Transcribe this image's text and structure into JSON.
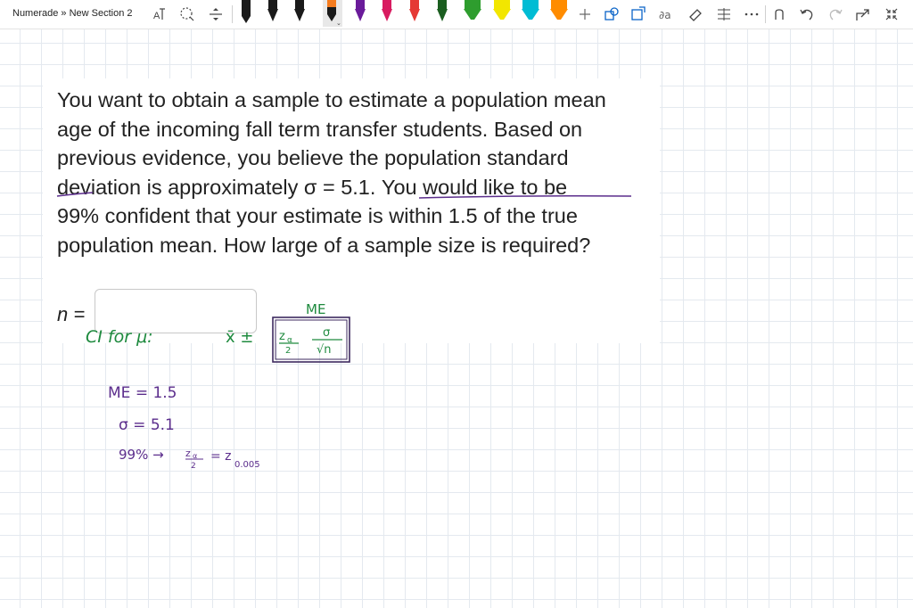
{
  "toolbar": {
    "breadcrumb": "Numerade » New Section 2",
    "pens": [
      {
        "name": "black",
        "color": "#1a1a1a"
      },
      {
        "name": "black-2",
        "color": "#1a1a1a"
      },
      {
        "name": "black-3",
        "color": "#1a1a1a"
      },
      {
        "name": "orange-selected",
        "color": "#f57c1f"
      },
      {
        "name": "purple",
        "color": "#6a1b9a"
      },
      {
        "name": "magenta",
        "color": "#d81b60"
      },
      {
        "name": "red",
        "color": "#e53935"
      },
      {
        "name": "green-dark",
        "color": "#1b5e20"
      },
      {
        "name": "green",
        "color": "#2e9d2e"
      },
      {
        "name": "yellow",
        "color": "#f2e600"
      },
      {
        "name": "cyan",
        "color": "#00bcd4"
      },
      {
        "name": "orange",
        "color": "#ff8c00"
      }
    ]
  },
  "question": {
    "lines": [
      "You want to obtain a sample to estimate a population mean",
      "age of the incoming fall term transfer students. Based on",
      "previous evidence, you believe the population standard",
      "deviation is approximately σ = 5.1. You would like to be",
      "99% confident that your estimate is within 1.5 of the true",
      "population mean. How large of a sample size is required?"
    ],
    "answer_label": "n =",
    "answer_value": ""
  },
  "ink": {
    "me_label": "ME",
    "ci_text": "CI for μ:",
    "xbar": "x̄ ±",
    "z_num": "z",
    "alpha": "α",
    "two": "2",
    "sigma": "σ",
    "sqrt_n": "√n",
    "me_eq": "ME = 1.5",
    "sigma_eq": "σ = 5.1",
    "pct": "99% →",
    "eq_z": "= z",
    "sub": "0.005",
    "green_color": "#1e8a3e",
    "purple_color": "#5b2d8c"
  }
}
